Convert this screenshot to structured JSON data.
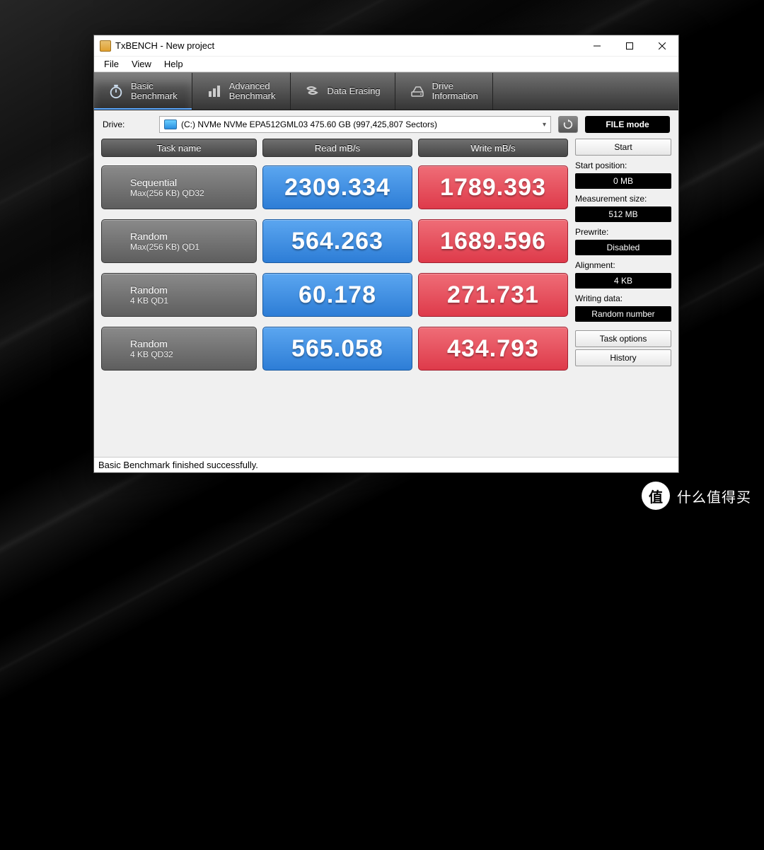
{
  "window": {
    "title": "TxBENCH - New project"
  },
  "menu": {
    "file": "File",
    "view": "View",
    "help": "Help"
  },
  "tabs": {
    "basic": {
      "line1": "Basic",
      "line2": "Benchmark"
    },
    "advanced": {
      "line1": "Advanced",
      "line2": "Benchmark"
    },
    "erase": {
      "line1": "Data Erasing"
    },
    "info": {
      "line1": "Drive",
      "line2": "Information"
    }
  },
  "drive": {
    "label": "Drive:",
    "value": "(C:) NVMe NVMe EPA512GML03  475.60 GB (997,425,807 Sectors)",
    "filemode": "FILE mode"
  },
  "headers": {
    "task": "Task name",
    "read": "Read mB/s",
    "write": "Write mB/s"
  },
  "rows": [
    {
      "name": "Sequential",
      "sub": "Max(256 KB) QD32",
      "read": "2309.334",
      "write": "1789.393"
    },
    {
      "name": "Random",
      "sub": "Max(256 KB) QD1",
      "read": "564.263",
      "write": "1689.596"
    },
    {
      "name": "Random",
      "sub": "4 KB QD1",
      "read": "60.178",
      "write": "271.731"
    },
    {
      "name": "Random",
      "sub": "4 KB QD32",
      "read": "565.058",
      "write": "434.793"
    }
  ],
  "side": {
    "start": "Start",
    "startpos_label": "Start position:",
    "startpos": "0 MB",
    "size_label": "Measurement size:",
    "size": "512 MB",
    "prewrite_label": "Prewrite:",
    "prewrite": "Disabled",
    "align_label": "Alignment:",
    "align": "4 KB",
    "wdata_label": "Writing data:",
    "wdata": "Random number",
    "taskopt": "Task options",
    "history": "History"
  },
  "status": "Basic Benchmark finished successfully.",
  "watermark": "什么值得买"
}
